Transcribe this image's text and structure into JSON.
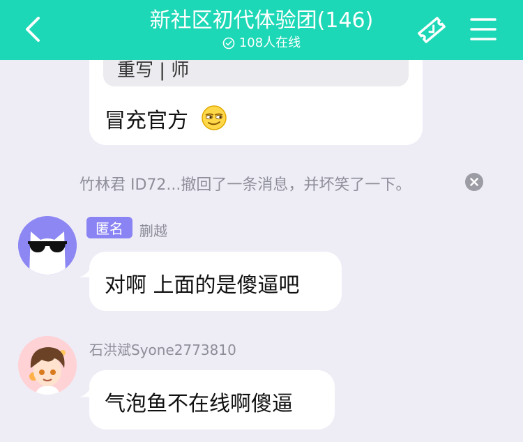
{
  "header": {
    "title": "新社区初代体验团(146)",
    "online": "108人在线",
    "accent": "#1dd8b6"
  },
  "icons": {
    "back": "chevron-left-icon",
    "online": "check-circle-icon",
    "ticket": "ticket-icon",
    "menu": "hamburger-menu-icon",
    "close": "close-icon",
    "emoji": "smirk-emoji-icon"
  },
  "messages": {
    "quoted_snippet": "重写 | 师",
    "top_text": "冒充官方",
    "recall_notice": "竹林君 ID72...撤回了一条消息，并坏笑了一下。",
    "msg1": {
      "badge": "匿名",
      "badge_color": "#8a83f3",
      "user": "蒯越",
      "text": "对啊 上面的是傻逼吧"
    },
    "msg2": {
      "user": "石洪斌Syone2773810",
      "text": "气泡鱼不在线啊傻逼"
    }
  }
}
